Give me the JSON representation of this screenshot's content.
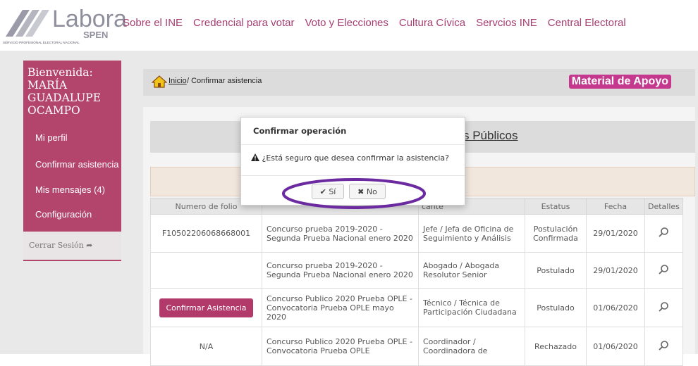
{
  "logo": {
    "word": "Labora",
    "spen": "SPEN",
    "subtitle": "SERVICIO PROFESIONAL ELECTORAL NACIONAL"
  },
  "nav": [
    "Sobre el INE",
    "Credencial para votar",
    "Voto y Elecciones",
    "Cultura Cívica",
    "Servcios INE",
    "Central Electoral"
  ],
  "sidebar": {
    "welcome": "Bienvenida: MARÍA GUADALUPE OCAMPO",
    "items": [
      "Mi perfil",
      "Confirmar asistencia",
      "Mis mensajes (4)",
      "Configuración"
    ],
    "logout": "Cerrar Sesión ➦"
  },
  "breadcrumb": {
    "inicio": "Inicio",
    "current": "/ Confirmar asistencia"
  },
  "material_button": "Material de Apoyo",
  "section_title": "s Públicos",
  "table": {
    "headers": [
      "Numero de folio",
      "",
      "cante",
      "Estatus",
      "Fecha",
      "Detalles"
    ],
    "rows": [
      {
        "folio": "F10502206068668001",
        "concurso": "Concurso prueba 2019-2020 - Segunda Prueba Nacional enero 2020",
        "puesto": "Jefe / Jefa de Oficina de Seguimiento y Análisis",
        "estatus": "Postulación Confirmada",
        "fecha": "29/01/2020"
      },
      {
        "folio": "",
        "concurso": "Concurso prueba 2019-2020 - Segunda Prueba Nacional enero 2020",
        "puesto": "Abogado / Abogada Resolutor Senior",
        "estatus": "Postulado",
        "fecha": "29/01/2020"
      },
      {
        "folio_button": "Confirmar Asistencia",
        "concurso": "Concurso Publico 2020 Prueba OPLE - Convocatoria Prueba OPLE mayo 2020",
        "puesto": "Técnico / Técnica de Participación Ciudadana",
        "estatus": "Postulado",
        "fecha": "01/06/2020"
      },
      {
        "folio": "N/A",
        "concurso": "Concurso Publico 2020 Prueba OPLE - Convocatoria Prueba OPLE",
        "puesto": "Coordinador / Coordinadora de",
        "estatus": "Rechazado",
        "fecha": "01/06/2020"
      }
    ]
  },
  "modal": {
    "title": "Confirmar operación",
    "message": "¿Está seguro que desea confirmar la asistencia?",
    "yes_label": "✔ Sí",
    "no_label": "✖ No"
  },
  "colors": {
    "accent": "#b3446c",
    "nav_text": "#a63e72",
    "highlight_ellipse": "#6b2aa0"
  }
}
